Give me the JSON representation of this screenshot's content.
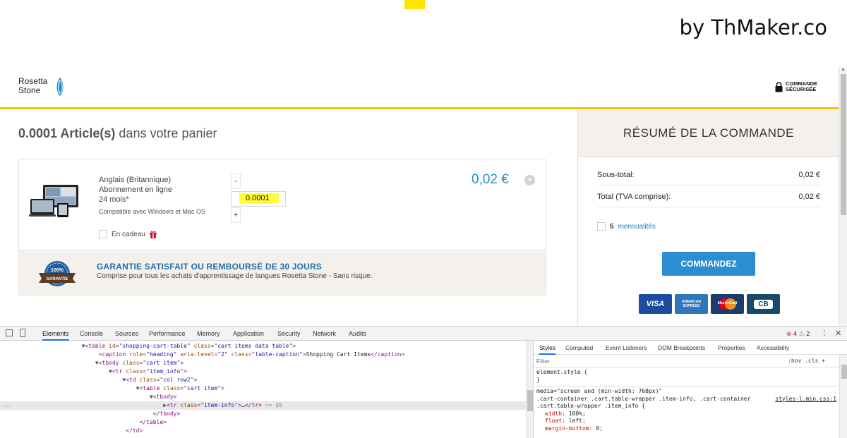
{
  "watermark": {
    "text": "by ThMaker.co"
  },
  "header": {
    "logo_line1": "Rosetta",
    "logo_line2": "Stone",
    "secure_line1": "COMMANDE",
    "secure_line2": "SÉCURISÉE"
  },
  "cart": {
    "count_bold": "0.0001 Article(s)",
    "title_rest": " dans votre panier",
    "item": {
      "line1": "Anglais (Britannique)",
      "line2": "Abonnement en ligne",
      "line3": "24 mois*",
      "compat": "Compatible avec Windows et Mac OS",
      "quantity": "0.0001",
      "minus": "-",
      "plus": "+",
      "price": "0,02 €",
      "remove": "×",
      "gift_label": "En cadeau"
    },
    "guarantee": {
      "badge_text": "100% GARANTIE",
      "title": "GARANTIE SATISFAIT OU REMBOURSÉ DE 30 JOURS",
      "subtitle": "Comprise pour tous les achats d'apprentissage de langues Rosetta Stone - Sans risque."
    }
  },
  "summary": {
    "title": "RÉSUMÉ DE LA COMMANDE",
    "subtotal_label": "Sous-total:",
    "subtotal_value": "0,02 €",
    "total_label": "Total (TVA comprise):",
    "total_value": "0,02 €",
    "installments_count": "5",
    "installments_label": "mensualités",
    "order_button": "COMMANDEZ",
    "cards": [
      {
        "label": "VISA",
        "color": "#1a4e9c"
      },
      {
        "label": "AMERICAN EXPRESS",
        "color": "#2e77bb"
      },
      {
        "label": "MasterCard",
        "color": "#1d3b6e"
      },
      {
        "label": "CB",
        "color": "#17496d"
      }
    ]
  },
  "devtools": {
    "tabs": [
      "Elements",
      "Console",
      "Sources",
      "Performance",
      "Memory",
      "Application",
      "Security",
      "Network",
      "Audits"
    ],
    "active_tab": "Elements",
    "errors": "4",
    "warnings": "2",
    "dom_lines": [
      {
        "indent": 12,
        "tri": "▼",
        "html": [
          [
            "tg",
            "<table "
          ],
          [
            "an",
            "id"
          ],
          [
            "tg",
            "=\""
          ],
          [
            "av",
            "shopping-cart-table"
          ],
          [
            "tg",
            "\" "
          ],
          [
            "an",
            "class"
          ],
          [
            "tg",
            "=\""
          ],
          [
            "av",
            "cart items data table"
          ],
          [
            "tg",
            "\">"
          ]
        ]
      },
      {
        "indent": 14,
        "tri": "",
        "html": [
          [
            "tg",
            "<caption "
          ],
          [
            "an",
            "role"
          ],
          [
            "tg",
            "=\""
          ],
          [
            "av",
            "heading"
          ],
          [
            "tg",
            "\" "
          ],
          [
            "an",
            "aria-level"
          ],
          [
            "tg",
            "=\""
          ],
          [
            "av",
            "2"
          ],
          [
            "tg",
            "\" "
          ],
          [
            "an",
            "class"
          ],
          [
            "tg",
            "=\""
          ],
          [
            "av",
            "table-caption"
          ],
          [
            "tg",
            "\">"
          ],
          [
            "tx",
            "Shopping Cart Items"
          ],
          [
            "tg",
            "</caption>"
          ]
        ]
      },
      {
        "indent": 14,
        "tri": "▼",
        "html": [
          [
            "tg",
            "<tbody "
          ],
          [
            "an",
            "class"
          ],
          [
            "tg",
            "=\""
          ],
          [
            "av",
            "cart item"
          ],
          [
            "tg",
            "\">"
          ]
        ]
      },
      {
        "indent": 16,
        "tri": "▼",
        "html": [
          [
            "tg",
            "<tr "
          ],
          [
            "an",
            "class"
          ],
          [
            "tg",
            "=\""
          ],
          [
            "av",
            "item_info"
          ],
          [
            "tg",
            "\">"
          ]
        ]
      },
      {
        "indent": 18,
        "tri": "▼",
        "html": [
          [
            "tg",
            "<td "
          ],
          [
            "an",
            "class"
          ],
          [
            "tg",
            "=\""
          ],
          [
            "av",
            "col row2"
          ],
          [
            "tg",
            "\">"
          ]
        ]
      },
      {
        "indent": 20,
        "tri": "▼",
        "html": [
          [
            "tg",
            "<table "
          ],
          [
            "an",
            "class"
          ],
          [
            "tg",
            "=\""
          ],
          [
            "av",
            "cart item"
          ],
          [
            "tg",
            "\">"
          ]
        ]
      },
      {
        "indent": 22,
        "tri": "▼",
        "html": [
          [
            "tg",
            "<tbody>"
          ]
        ]
      },
      {
        "indent": 24,
        "tri": "▶",
        "html": [
          [
            "tg",
            "<tr "
          ],
          [
            "an",
            "class"
          ],
          [
            "tg",
            "=\""
          ],
          [
            "av",
            "item-info"
          ],
          [
            "tg",
            "\">"
          ],
          [
            "tx",
            "…"
          ],
          [
            "tg",
            "</tr>"
          ],
          [
            "cm",
            " == $0"
          ]
        ],
        "selected": true
      },
      {
        "indent": 22,
        "tri": "",
        "html": [
          [
            "tg",
            "</tbody>"
          ]
        ]
      },
      {
        "indent": 20,
        "tri": "",
        "html": [
          [
            "tg",
            "</table>"
          ]
        ]
      },
      {
        "indent": 18,
        "tri": "",
        "html": [
          [
            "tg",
            "</td>"
          ]
        ]
      }
    ],
    "style_tabs": [
      "Styles",
      "Computed",
      "Event Listeners",
      "DOM Breakpoints",
      "Properties",
      "Accessibility"
    ],
    "filter_placeholder": "Filter",
    "hov_cls": ":hov  .cls  +",
    "element_style": "element.style {",
    "close_brace": "}",
    "media": "media=\"screen and (min-width: 768px)\"",
    "selector1": ".cart-container .cart.table-wrapper .item-info, .cart-container",
    "selector2": ".cart.table-wrapper .item_info {",
    "source": "styles-l.min.css:1",
    "props": [
      {
        "name": "width",
        "value": "100%;"
      },
      {
        "name": "float",
        "value": "left;"
      },
      {
        "name": "margin-bottom",
        "value": "0;"
      }
    ]
  }
}
